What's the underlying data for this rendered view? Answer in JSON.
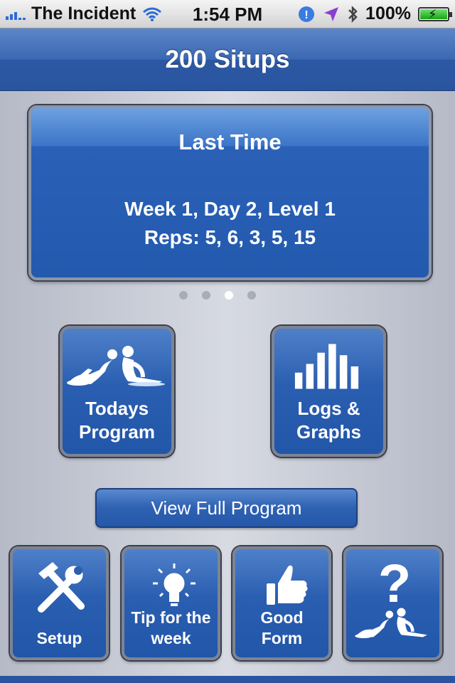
{
  "status_bar": {
    "carrier": "The Incident",
    "time": "1:54 PM",
    "battery": "100%"
  },
  "nav": {
    "title": "200 Situps"
  },
  "last_time": {
    "title": "Last Time",
    "line1": "Week 1, Day  2, Level 1",
    "line2": "Reps: 5, 6, 3, 5, 15"
  },
  "page_dots": {
    "count": 4,
    "active_index": 2
  },
  "buttons": {
    "todays_program": {
      "line1": "Todays",
      "line2": "Program"
    },
    "logs_graphs": {
      "line1": "Logs &",
      "line2": "Graphs"
    },
    "view_full_program": "View Full Program",
    "setup": "Setup",
    "tip": {
      "line1": "Tip for the",
      "line2": "week"
    },
    "good_form": {
      "line1": "Good",
      "line2": "Form"
    }
  },
  "colors": {
    "accent_blue": "#2a5eb0",
    "nav_blue": "#3b68b3"
  }
}
